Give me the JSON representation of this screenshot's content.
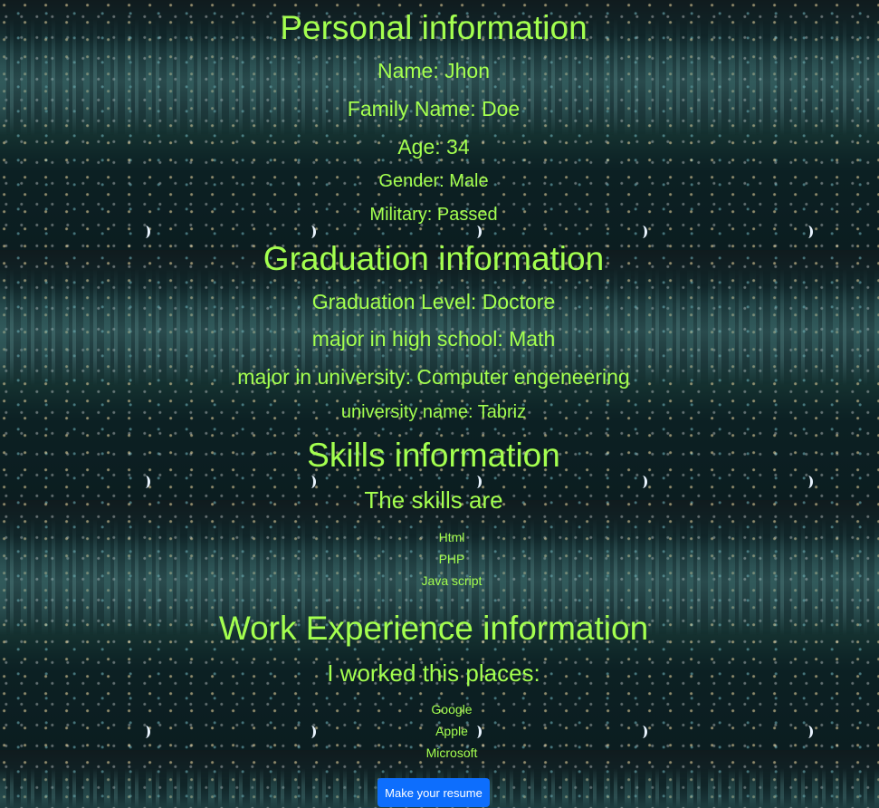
{
  "personal": {
    "heading": "Personal information",
    "name": "Name: Jhon",
    "family_name": "Family Name: Doe",
    "age": "Age: 34",
    "gender": "Gender: Male",
    "military": "Military: Passed"
  },
  "graduation": {
    "heading": "Graduation information",
    "level": "Graduation Level: Doctore",
    "high_school_major": "major in high school: Math",
    "university_major": "major in university: Computer engeneering",
    "university_name": "university name: Tabriz"
  },
  "skills": {
    "heading": "Skills information",
    "subheading": "The skills are",
    "items": [
      "Html",
      "PHP",
      "Java script"
    ]
  },
  "work": {
    "heading": "Work Experience information",
    "subheading": "I worked this places:",
    "items": [
      "Google",
      "Apple",
      "Microsoft"
    ]
  },
  "actions": {
    "make_resume_label": "Make your resume"
  },
  "colors": {
    "text": "#a4ff4f",
    "button": "#0d6efd"
  }
}
